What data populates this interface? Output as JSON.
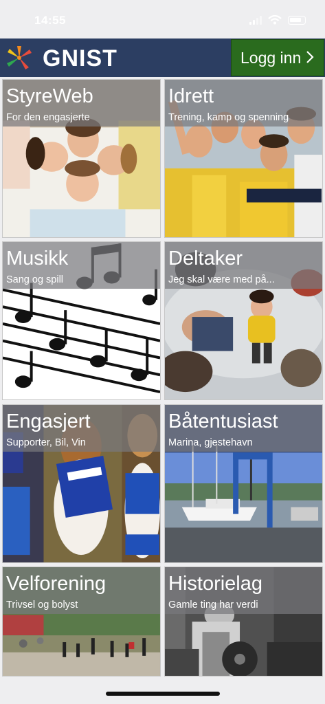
{
  "status": {
    "time": "14:55"
  },
  "header": {
    "brand": "GNIST",
    "login_label": "Logg inn"
  },
  "tiles": [
    {
      "title": "StyreWeb",
      "subtitle": "For den engasjerte"
    },
    {
      "title": "Idrett",
      "subtitle": "Trening, kamp og spenning"
    },
    {
      "title": "Musikk",
      "subtitle": "Sang og spill"
    },
    {
      "title": "Deltaker",
      "subtitle": "Jeg skal være med på..."
    },
    {
      "title": "Engasjert",
      "subtitle": "Supporter, Bil, Vin"
    },
    {
      "title": "Båtentusiast",
      "subtitle": "Marina, gjestehavn"
    },
    {
      "title": "Velforening",
      "subtitle": "Trivsel og bolyst"
    },
    {
      "title": "Historielag",
      "subtitle": "Gamle ting har verdi"
    }
  ],
  "colors": {
    "header_bg": "#2c3e62",
    "login_bg": "#2a6b1e",
    "page_bg": "#eeeef0"
  }
}
